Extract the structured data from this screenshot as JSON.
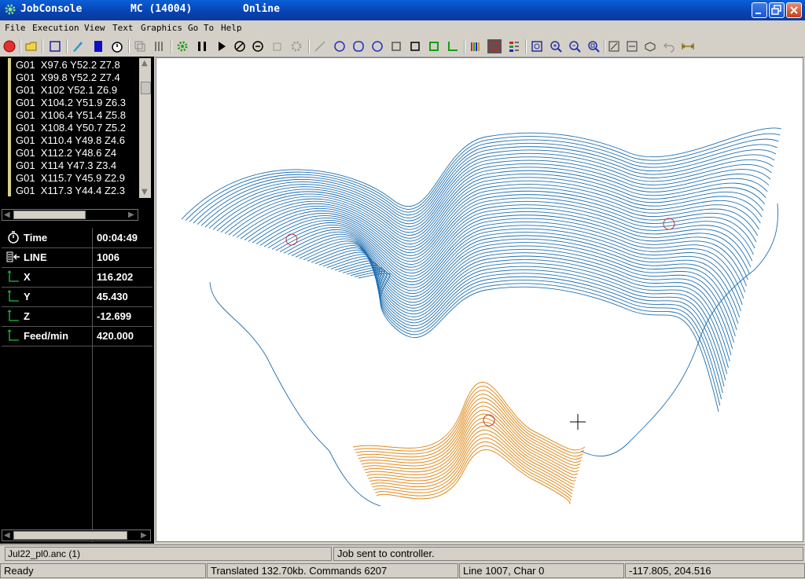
{
  "title_bar": {
    "app_name": "JobConsole",
    "machine": "MC (14004)",
    "connection": "Online"
  },
  "menu": [
    "File",
    "Execution",
    "View",
    "Text",
    "Graphics",
    "Go To",
    "Help"
  ],
  "toolbar_icons": [
    "stop-icon",
    "open-folder-icon",
    "select-icon",
    "edit-icon",
    "bookmark-icon",
    "stopwatch-icon",
    "copy-icon",
    "columns-icon",
    "settings-gear-icon",
    "pause-icon",
    "play-icon",
    "cancel-icon",
    "cycle-icon",
    "disabled-tool-icon",
    "disabled-gear-icon",
    "line-icon",
    "circle-cw-icon",
    "circle-icon",
    "circle-ccw-icon",
    "square-dark-icon",
    "square-icon",
    "square-green-icon",
    "axes-icon",
    "color-bars-icon",
    "circle-toggle-icon",
    "legend-icon",
    "fit-view-icon",
    "zoom-in-icon",
    "zoom-out-icon",
    "zoom-window-icon",
    "view-top-icon",
    "view-front-icon",
    "view-iso-icon",
    "undo-icon",
    "measure-icon"
  ],
  "gcode_lines": [
    "G01  X97.6 Y52.2 Z7.8",
    "G01  X99.8 Y52.2 Z7.4",
    "G01  X102 Y52.1 Z6.9",
    "G01  X104.2 Y51.9 Z6.3",
    "G01  X106.4 Y51.4 Z5.8",
    "G01  X108.4 Y50.7 Z5.2",
    "G01  X110.4 Y49.8 Z4.6",
    "G01  X112.2 Y48.6 Z4",
    "G01  X114 Y47.3 Z3.4",
    "G01  X115.7 Y45.9 Z2.9",
    "G01  X117.3 Y44.4 Z2.3"
  ],
  "status": [
    {
      "icon": "stopwatch-icon",
      "label": "Time",
      "value": "00:04:49"
    },
    {
      "icon": "line-pointer-icon",
      "label": "LINE",
      "value": "1006"
    },
    {
      "icon": "axis-icon",
      "label": "X",
      "value": "116.202"
    },
    {
      "icon": "axis-icon",
      "label": "Y",
      "value": "45.430"
    },
    {
      "icon": "axis-icon",
      "label": "Z",
      "value": "-12.699"
    },
    {
      "icon": "axis-icon",
      "label": "Feed/min",
      "value": "420.000"
    }
  ],
  "toolpath": {
    "completed_color": "#e08a1c",
    "pending_color": "#1f6fb0",
    "marker_color": "#c0303a"
  },
  "file_bar": {
    "file_name": "Jul22_pl0.anc (1)",
    "message": "Job sent to controller."
  },
  "status_bar": {
    "state": "Ready",
    "translated": "Translated 132.70kb. Commands 6207",
    "position": "Line 1007, Char 0",
    "coords": "-117.805, 204.516"
  }
}
